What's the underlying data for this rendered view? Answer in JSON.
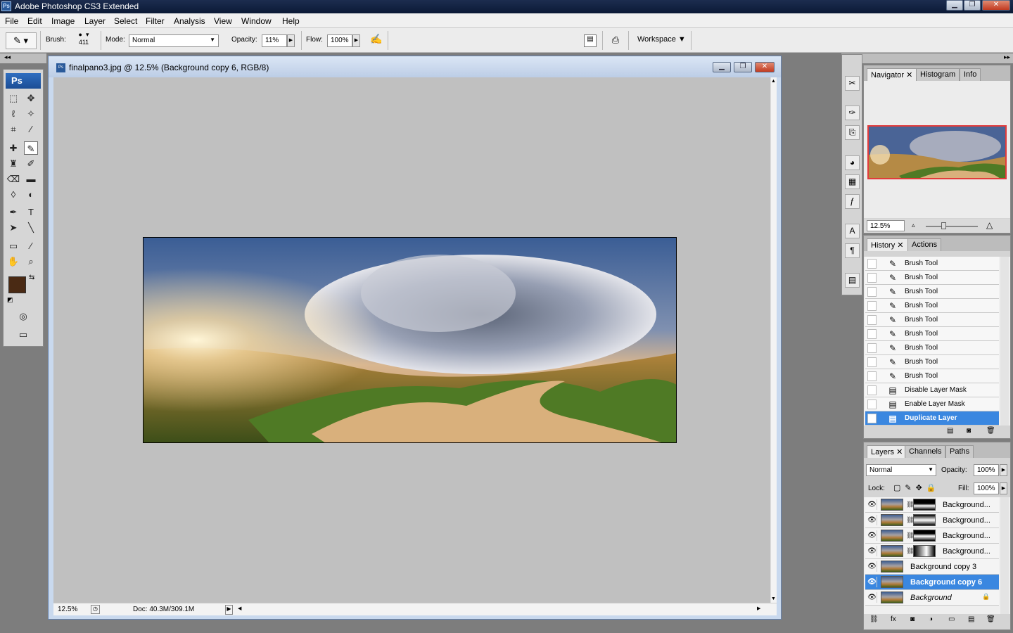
{
  "app": {
    "title": "Adobe Photoshop CS3 Extended",
    "logo": "Ps"
  },
  "window_controls": {
    "minimize": "▁",
    "restore": "❐",
    "close": "✕"
  },
  "menu": [
    "File",
    "Edit",
    "Image",
    "Layer",
    "Select",
    "Filter",
    "Analysis",
    "View",
    "Window",
    "Help"
  ],
  "options": {
    "brush_label": "Brush:",
    "brush_size": "411",
    "mode_label": "Mode:",
    "mode_value": "Normal",
    "opacity_label": "Opacity:",
    "opacity_value": "11%",
    "flow_label": "Flow:",
    "flow_value": "100%",
    "workspace_label": "Workspace"
  },
  "toolbox": {
    "logo": "Ps"
  },
  "document": {
    "title": "finalpano3.jpg @ 12.5% (Background copy 6, RGB/8)",
    "zoom": "12.5%",
    "doc_info": "Doc: 40.3M/309.1M"
  },
  "navigator": {
    "tabs": [
      "Navigator",
      "Histogram",
      "Info"
    ],
    "zoom": "12.5%"
  },
  "history": {
    "tabs": [
      "History",
      "Actions"
    ],
    "items": [
      "Brush Tool",
      "Brush Tool",
      "Brush Tool",
      "Brush Tool",
      "Brush Tool",
      "Brush Tool",
      "Brush Tool",
      "Brush Tool",
      "Brush Tool",
      "Disable Layer Mask",
      "Enable Layer Mask",
      "Duplicate Layer"
    ],
    "selected_index": 11
  },
  "layers": {
    "tabs": [
      "Layers",
      "Channels",
      "Paths"
    ],
    "blend_mode": "Normal",
    "opacity_label": "Opacity:",
    "opacity_value": "100%",
    "lock_label": "Lock:",
    "fill_label": "Fill:",
    "fill_value": "100%",
    "items": [
      {
        "name": "Background..."
      },
      {
        "name": "Background..."
      },
      {
        "name": "Background..."
      },
      {
        "name": "Background..."
      },
      {
        "name": "Background copy 3"
      },
      {
        "name": "Background copy 6"
      },
      {
        "name": "Background"
      }
    ],
    "selected_index": 5
  },
  "colors": {
    "foreground": "#4a2a14",
    "background": "#ffffff",
    "selection": "#3a87e0"
  }
}
